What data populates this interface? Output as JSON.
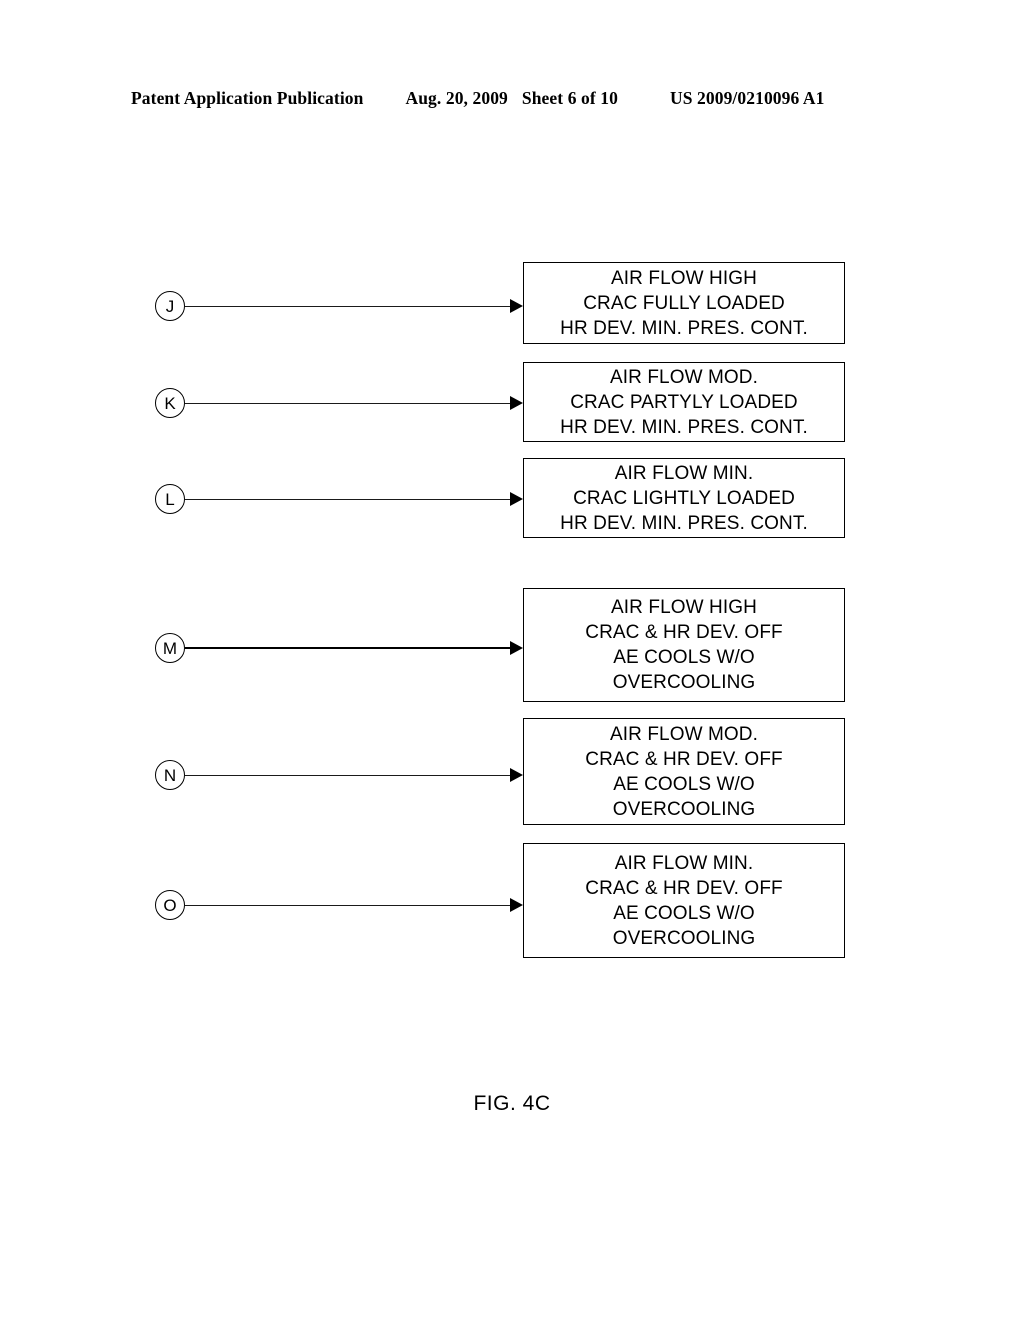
{
  "header": {
    "publication": "Patent Application Publication",
    "date": "Aug. 20, 2009",
    "sheet": "Sheet 6 of 10",
    "patent_number": "US 2009/0210096 A1"
  },
  "figure": {
    "caption": "FIG. 4C",
    "nodes": [
      {
        "tag": "J",
        "lines": [
          "AIR FLOW HIGH",
          "CRAC FULLY LOADED",
          "HR DEV. MIN. PRES. CONT."
        ]
      },
      {
        "tag": "K",
        "lines": [
          "AIR FLOW MOD.",
          "CRAC PARTYLY LOADED",
          "HR DEV. MIN. PRES. CONT."
        ]
      },
      {
        "tag": "L",
        "lines": [
          "AIR FLOW MIN.",
          "CRAC LIGHTLY LOADED",
          "HR DEV. MIN. PRES. CONT."
        ]
      },
      {
        "tag": "M",
        "lines": [
          "AIR FLOW HIGH",
          "CRAC & HR DEV. OFF",
          "AE COOLS W/O",
          "OVERCOOLING"
        ]
      },
      {
        "tag": "N",
        "lines": [
          "AIR FLOW MOD.",
          "CRAC & HR DEV. OFF",
          "AE COOLS W/O",
          "OVERCOOLING"
        ]
      },
      {
        "tag": "O",
        "lines": [
          "AIR FLOW MIN.",
          "CRAC & HR DEV. OFF",
          "AE COOLS W/O",
          "OVERCOOLING"
        ]
      }
    ]
  },
  "colors": {
    "ink": "#000000",
    "paper": "#ffffff"
  }
}
